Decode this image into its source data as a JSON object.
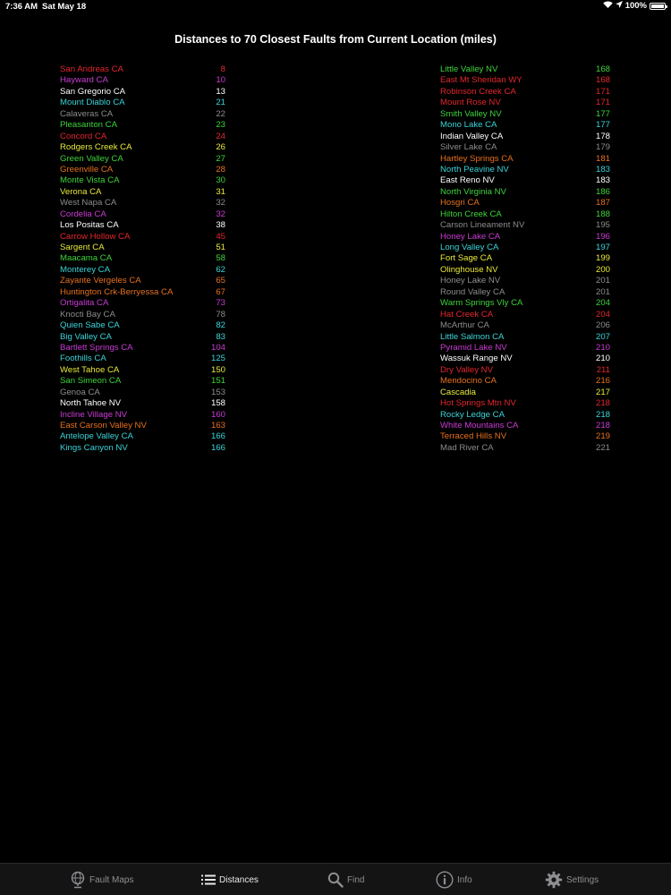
{
  "status_bar": {
    "time": "7:36 AM",
    "date": "Sat May 18",
    "battery": "100%",
    "battery_level": 1.0
  },
  "title": "Distances to 70 Closest Faults from Current Location (miles)",
  "colors": {
    "red": "#e3262d",
    "magenta": "#c93bd3",
    "white": "#ffffff",
    "cyan": "#3bd3d8",
    "gray": "#8c8c8c",
    "green": "#3ed33b",
    "orange": "#e6711e",
    "yellow": "#e9e93b"
  },
  "faults_left": [
    {
      "name": "San Andreas CA",
      "distance": "8",
      "color": "#e3262d"
    },
    {
      "name": "Hayward CA",
      "distance": "10",
      "color": "#c93bd3"
    },
    {
      "name": "San Gregorio CA",
      "distance": "13",
      "color": "#ffffff"
    },
    {
      "name": "Mount Diablo CA",
      "distance": "21",
      "color": "#3bd3d8"
    },
    {
      "name": "Calaveras CA",
      "distance": "22",
      "color": "#8c8c8c"
    },
    {
      "name": "Pleasanton CA",
      "distance": "23",
      "color": "#3ed33b"
    },
    {
      "name": "Concord CA",
      "distance": "24",
      "color": "#e3262d"
    },
    {
      "name": "Rodgers Creek CA",
      "distance": "26",
      "color": "#e9e93b"
    },
    {
      "name": "Green Valley CA",
      "distance": "27",
      "color": "#3ed33b"
    },
    {
      "name": "Greenville CA",
      "distance": "28",
      "color": "#e6711e"
    },
    {
      "name": "Monte Vista CA",
      "distance": "30",
      "color": "#3ed33b"
    },
    {
      "name": "Verona CA",
      "distance": "31",
      "color": "#e9e93b"
    },
    {
      "name": "West Napa CA",
      "distance": "32",
      "color": "#8c8c8c"
    },
    {
      "name": "Cordelia CA",
      "distance": "32",
      "color": "#c93bd3"
    },
    {
      "name": "Los Positas CA",
      "distance": "38",
      "color": "#ffffff"
    },
    {
      "name": "Carrow Hollow CA",
      "distance": "45",
      "color": "#e3262d"
    },
    {
      "name": "Sargent CA",
      "distance": "51",
      "color": "#e9e93b"
    },
    {
      "name": "Maacama CA",
      "distance": "58",
      "color": "#3ed33b"
    },
    {
      "name": "Monterey CA",
      "distance": "62",
      "color": "#3bd3d8"
    },
    {
      "name": "Zayante Vergeles CA",
      "distance": "65",
      "color": "#e6711e"
    },
    {
      "name": "Huntington Crk-Berryessa CA",
      "distance": "67",
      "color": "#e6711e"
    },
    {
      "name": "Ortigalita CA",
      "distance": "73",
      "color": "#c93bd3"
    },
    {
      "name": "Knocti Bay CA",
      "distance": "78",
      "color": "#8c8c8c"
    },
    {
      "name": "Quien Sabe CA",
      "distance": "82",
      "color": "#3bd3d8"
    },
    {
      "name": "Big Valley CA",
      "distance": "83",
      "color": "#3bd3d8"
    },
    {
      "name": "Bartlett Springs CA",
      "distance": "104",
      "color": "#c93bd3"
    },
    {
      "name": "Foothills CA",
      "distance": "125",
      "color": "#3bd3d8"
    },
    {
      "name": "West Tahoe CA",
      "distance": "150",
      "color": "#e9e93b"
    },
    {
      "name": "San Simeon CA",
      "distance": "151",
      "color": "#3ed33b"
    },
    {
      "name": "Genoa CA",
      "distance": "153",
      "color": "#8c8c8c"
    },
    {
      "name": "North Tahoe NV",
      "distance": "158",
      "color": "#ffffff"
    },
    {
      "name": "Incline Village NV",
      "distance": "160",
      "color": "#c93bd3"
    },
    {
      "name": "East Carson Valley NV",
      "distance": "163",
      "color": "#e6711e"
    },
    {
      "name": "Antelope Valley CA",
      "distance": "166",
      "color": "#3bd3d8"
    },
    {
      "name": "Kings Canyon NV",
      "distance": "166",
      "color": "#3bd3d8"
    }
  ],
  "faults_right": [
    {
      "name": "Little Valley NV",
      "distance": "168",
      "color": "#3ed33b"
    },
    {
      "name": "East Mt Sheridan WY",
      "distance": "168",
      "color": "#e3262d"
    },
    {
      "name": "Robinson Creek CA",
      "distance": "171",
      "color": "#e3262d"
    },
    {
      "name": "Mount Rose NV",
      "distance": "171",
      "color": "#e3262d"
    },
    {
      "name": "Smith Valley NV",
      "distance": "177",
      "color": "#3ed33b"
    },
    {
      "name": "Mono Lake CA",
      "distance": "177",
      "color": "#3bd3d8"
    },
    {
      "name": "Indian Valley CA",
      "distance": "178",
      "color": "#ffffff"
    },
    {
      "name": "Silver Lake CA",
      "distance": "179",
      "color": "#8c8c8c"
    },
    {
      "name": "Hartley Springs CA",
      "distance": "181",
      "color": "#e6711e"
    },
    {
      "name": "North Peavine NV",
      "distance": "183",
      "color": "#3bd3d8"
    },
    {
      "name": "East Reno NV",
      "distance": "183",
      "color": "#ffffff"
    },
    {
      "name": "North Virginia NV",
      "distance": "186",
      "color": "#3ed33b"
    },
    {
      "name": "Hosgri CA",
      "distance": "187",
      "color": "#e6711e"
    },
    {
      "name": "Hilton Creek CA",
      "distance": "188",
      "color": "#3ed33b"
    },
    {
      "name": "Carson Lineament NV",
      "distance": "195",
      "color": "#8c8c8c"
    },
    {
      "name": "Honey Lake CA",
      "distance": "196",
      "color": "#c93bd3"
    },
    {
      "name": "Long Valley CA",
      "distance": "197",
      "color": "#3bd3d8"
    },
    {
      "name": "Fort Sage CA",
      "distance": "199",
      "color": "#e9e93b"
    },
    {
      "name": "Olinghouse NV",
      "distance": "200",
      "color": "#e9e93b"
    },
    {
      "name": "Honey Lake NV",
      "distance": "201",
      "color": "#8c8c8c"
    },
    {
      "name": "Round Valley CA",
      "distance": "201",
      "color": "#8c8c8c"
    },
    {
      "name": "Warm Springs Vly CA",
      "distance": "204",
      "color": "#3ed33b"
    },
    {
      "name": "Hat Creek CA",
      "distance": "204",
      "color": "#e3262d"
    },
    {
      "name": "McArthur CA",
      "distance": "206",
      "color": "#8c8c8c"
    },
    {
      "name": "Little Salmon CA",
      "distance": "207",
      "color": "#3bd3d8"
    },
    {
      "name": "Pyramid Lake NV",
      "distance": "210",
      "color": "#c93bd3"
    },
    {
      "name": "Wassuk Range NV",
      "distance": "210",
      "color": "#ffffff"
    },
    {
      "name": "Dry Valley NV",
      "distance": "211",
      "color": "#e3262d"
    },
    {
      "name": "Mendocino CA",
      "distance": "216",
      "color": "#e6711e"
    },
    {
      "name": "Cascadia",
      "distance": "217",
      "color": "#e9e93b"
    },
    {
      "name": "Hot Springs Mtn NV",
      "distance": "218",
      "color": "#e3262d"
    },
    {
      "name": "Rocky Ledge CA",
      "distance": "218",
      "color": "#3bd3d8"
    },
    {
      "name": "White Mountains CA",
      "distance": "218",
      "color": "#c93bd3"
    },
    {
      "name": "Terraced Hills NV",
      "distance": "219",
      "color": "#e6711e"
    },
    {
      "name": "Mad River CA",
      "distance": "221",
      "color": "#8c8c8c"
    }
  ],
  "tabbar": {
    "active_index": 1,
    "tabs": [
      {
        "label": "Fault Maps",
        "icon": "globe-icon"
      },
      {
        "label": "Distances",
        "icon": "list-icon"
      },
      {
        "label": "Find",
        "icon": "search-icon"
      },
      {
        "label": "Info",
        "icon": "info-icon"
      },
      {
        "label": "Settings",
        "icon": "gear-icon"
      }
    ]
  }
}
